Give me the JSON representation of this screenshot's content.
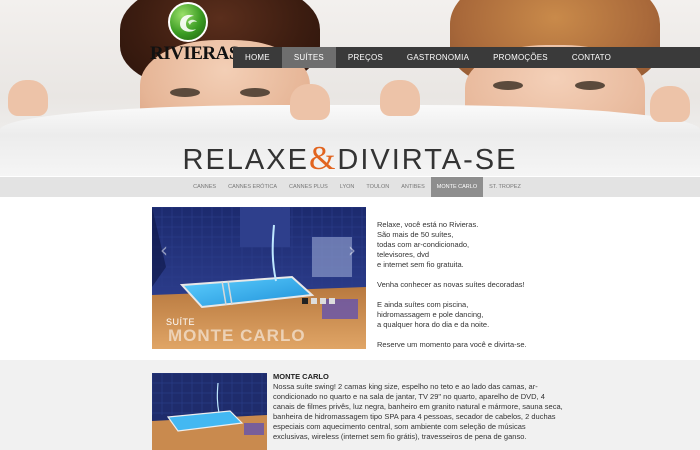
{
  "brand": {
    "name": "RIVIERAS"
  },
  "nav": {
    "items": [
      {
        "label": "HOME",
        "active": false
      },
      {
        "label": "SUÍTES",
        "active": true
      },
      {
        "label": "PREÇOS",
        "active": false
      },
      {
        "label": "GASTRONOMIA",
        "active": false
      },
      {
        "label": "PROMOÇÕES",
        "active": false
      },
      {
        "label": "CONTATO",
        "active": false
      }
    ]
  },
  "headline": {
    "part1": "RELAXE",
    "amp": "&",
    "part2": "DIVIRTA-SE"
  },
  "subnav": {
    "items": [
      {
        "label": "CANNES",
        "active": false
      },
      {
        "label": "CANNES ERÓTICA",
        "active": false
      },
      {
        "label": "CANNES PLUS",
        "active": false
      },
      {
        "label": "LYON",
        "active": false
      },
      {
        "label": "TOULON",
        "active": false
      },
      {
        "label": "ANTIBES",
        "active": false
      },
      {
        "label": "MONTE CARLO",
        "active": true
      },
      {
        "label": "ST. TROPEZ",
        "active": false
      }
    ]
  },
  "feature": {
    "caption_small": "SUÍTE",
    "caption_large": "MONTE CARLO",
    "slides": 4,
    "active_slide": 1,
    "paragraphs": [
      "Relaxe, você está no Rivieras.\nSão mais de 50 suítes,\ntodas com ar-condicionado,\ntelevisores, dvd\ne internet sem fio gratuita.",
      "Venha conhecer as novas suítes decoradas!",
      "E ainda suítes com piscina,\nhidromassagem e pole dancing,\na qualquer hora do dia e da noite.",
      "Reserve um momento para você e divirta-se."
    ]
  },
  "suite": {
    "title": "MONTE CARLO",
    "description": "Nossa suíte swing! 2 camas king size, espelho no teto e ao lado das camas, ar-condicionado no quarto e na sala de jantar, TV 29\" no quarto, aparelho de DVD, 4 canais de filmes privês, luz negra, banheiro em granito natural e mármore, sauna seca, banheira de hidromassagem tipo SPA para 4 pessoas, secador de cabelos, 2 duchas especiais com aquecimento central, som ambiente com seleção de músicas exclusivas, wireless (internet sem fio grátis), travesseiros de pena de ganso."
  },
  "colors": {
    "accent": "#e2641f",
    "nav_bg": "#3a3a3a",
    "nav_active": "#6e6e6e",
    "subnav_bg": "#e3e3e3",
    "subnav_active": "#8e8e8e",
    "brand_green": "#3a9b22"
  }
}
